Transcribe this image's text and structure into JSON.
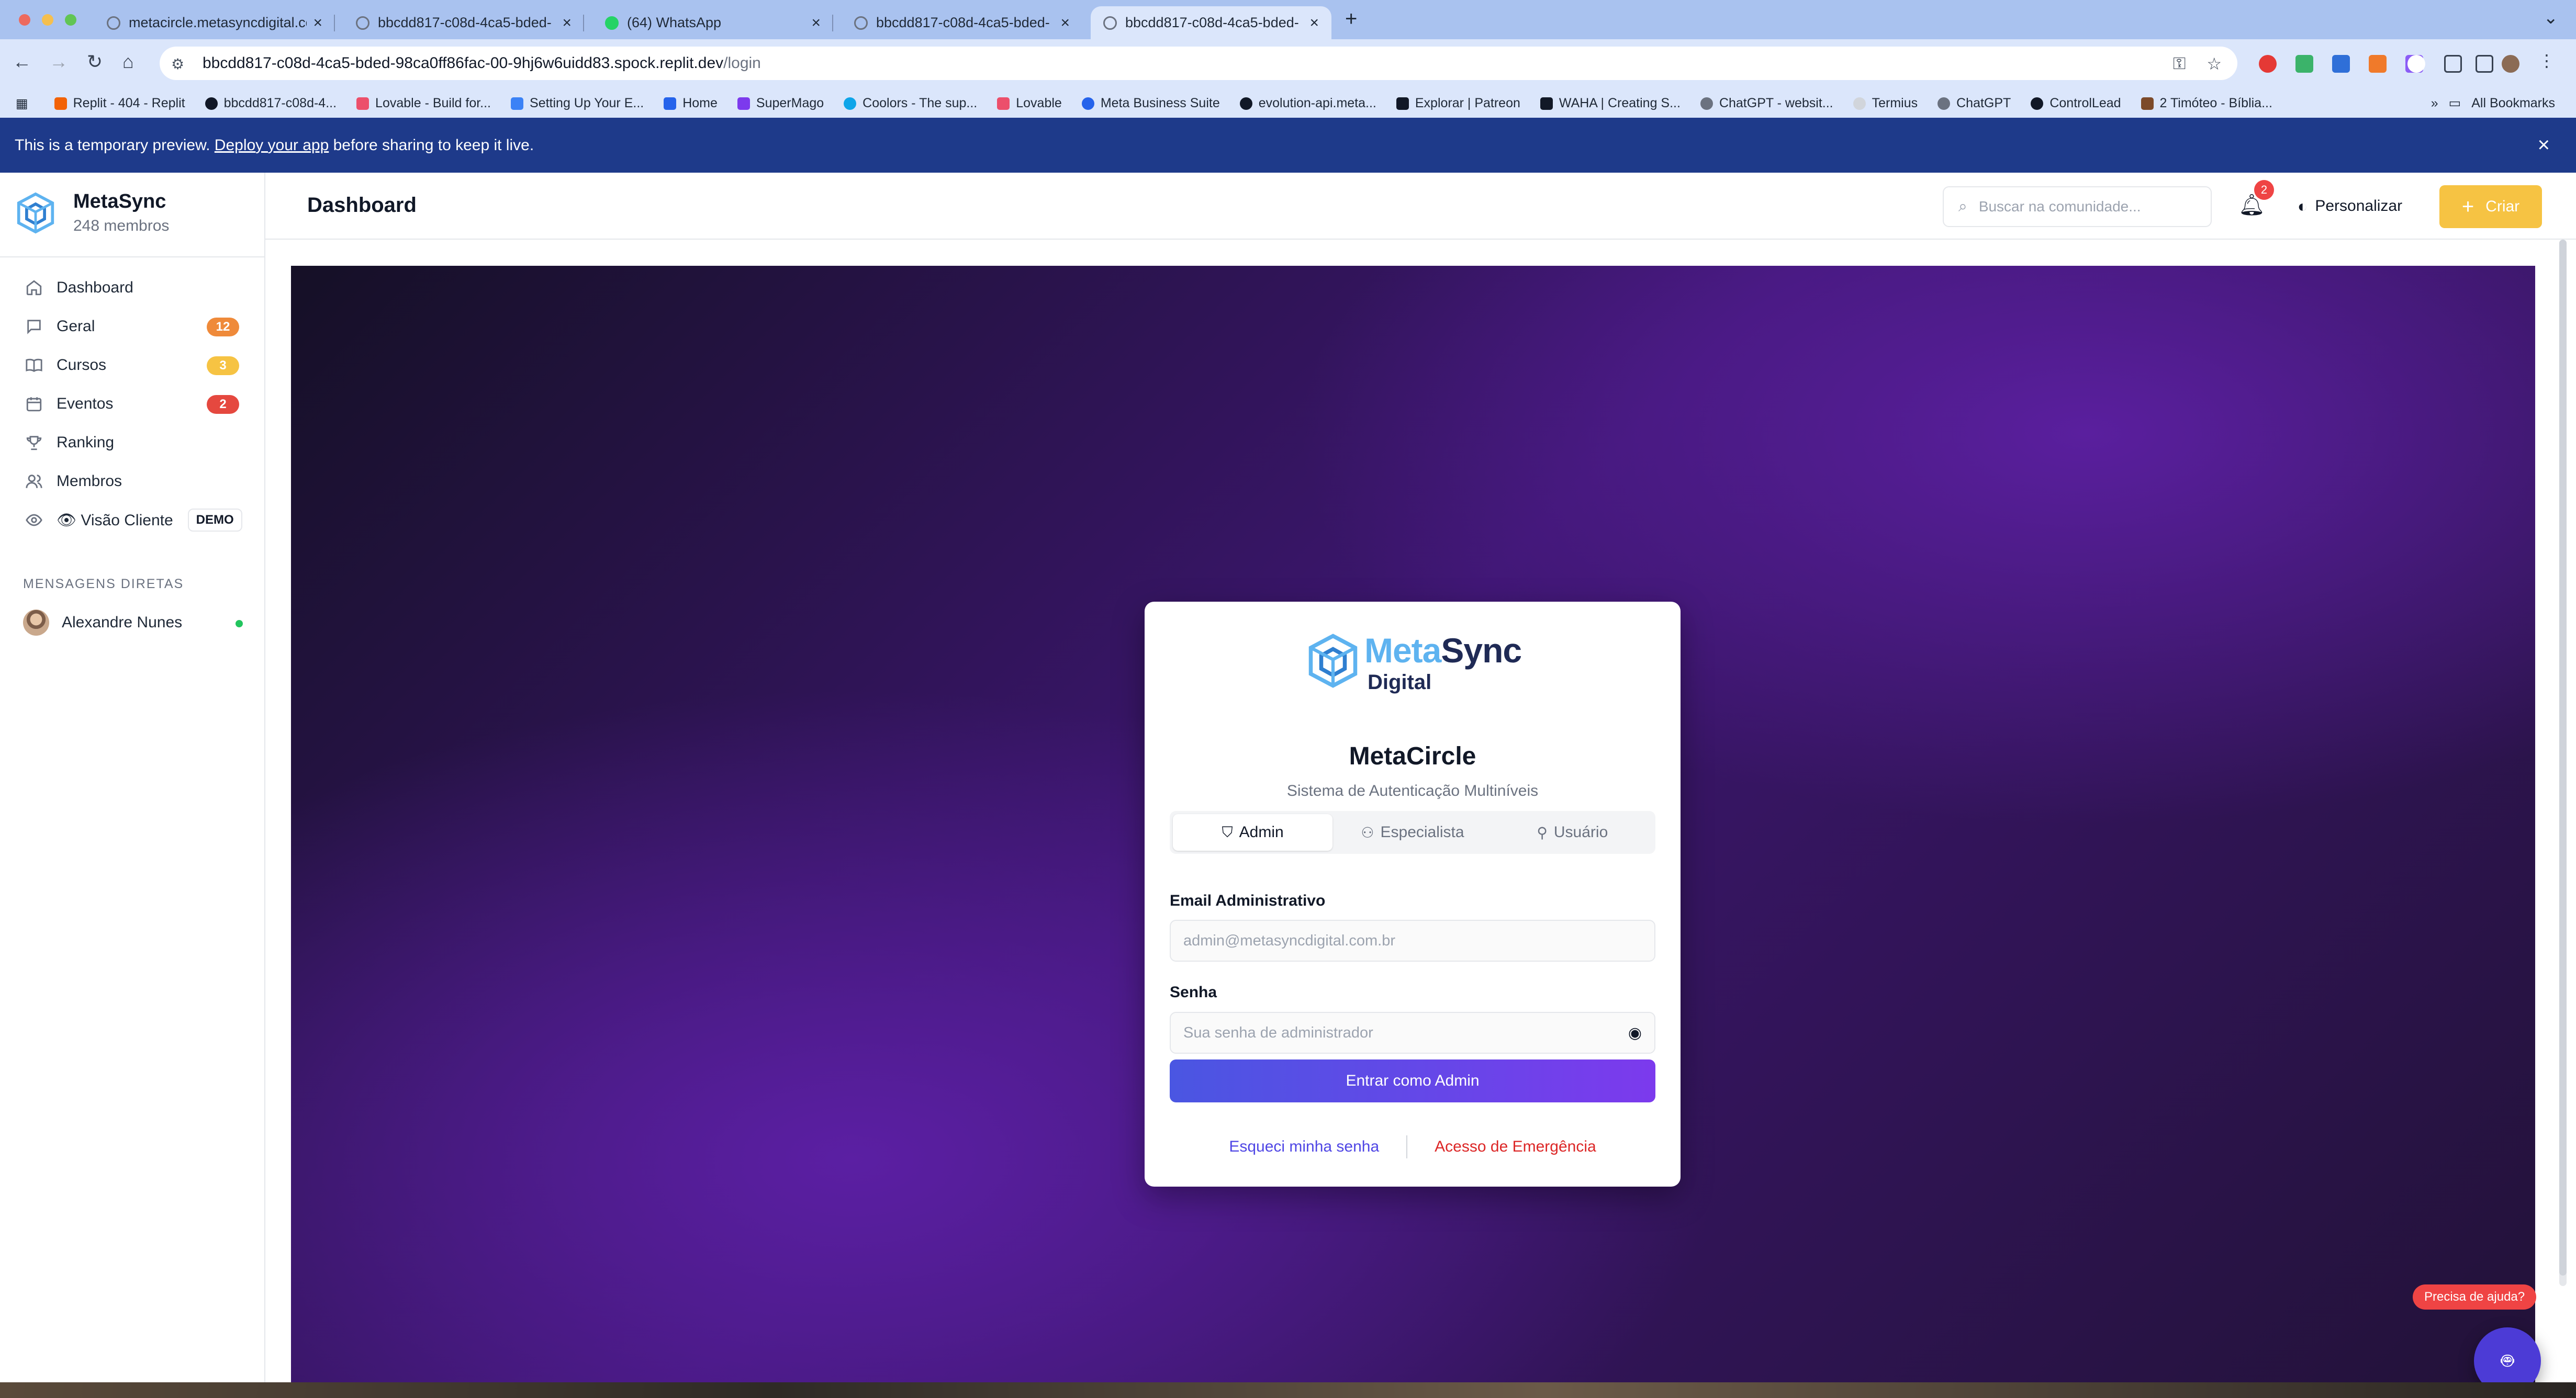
{
  "browser": {
    "tabs": [
      {
        "title": "metacircle.metasyncdigital.co",
        "active": false
      },
      {
        "title": "bbcdd817-c08d-4ca5-bded-",
        "active": false
      },
      {
        "title": "(64) WhatsApp",
        "active": false
      },
      {
        "title": "bbcdd817-c08d-4ca5-bded-",
        "active": false
      },
      {
        "title": "bbcdd817-c08d-4ca5-bded-",
        "active": true
      }
    ],
    "url_host": "bbcdd817-c08d-4ca5-bded-98ca0ff86fac-00-9hj6w6uidd83.spock.replit.dev",
    "url_path": "/login",
    "bookmarks": [
      "Replit - 404 - Replit",
      "bbcdd817-c08d-4...",
      "Lovable - Build for...",
      "Setting Up Your E...",
      "Home",
      "SuperMago",
      "Coolors - The sup...",
      "Lovable",
      "Meta Business Suite",
      "evolution-api.meta...",
      "Explorar | Patreon",
      "WAHA | Creating S...",
      "ChatGPT - websit...",
      "Termius",
      "ChatGPT",
      "ControlLead",
      "2 Timóteo - Bíblia..."
    ],
    "bookmarks_more": "»",
    "all_bookmarks": "All Bookmarks"
  },
  "banner": {
    "prefix": "This is a temporary preview. ",
    "link": "Deploy your app",
    "suffix": " before sharing to keep it live."
  },
  "sidebar": {
    "brand_name": "MetaSync",
    "brand_sub": "248 membros",
    "items": [
      {
        "label": "Dashboard",
        "icon": "home-icon",
        "badge": ""
      },
      {
        "label": "Geral",
        "icon": "chat-icon",
        "badge": "12",
        "badge_color": "#ef8a3a"
      },
      {
        "label": "Cursos",
        "icon": "book-icon",
        "badge": "3",
        "badge_color": "#f6c343"
      },
      {
        "label": "Eventos",
        "icon": "calendar-icon",
        "badge": "2",
        "badge_color": "#e5483f"
      },
      {
        "label": "Ranking",
        "icon": "trophy-icon",
        "badge": ""
      },
      {
        "label": "Membros",
        "icon": "users-icon",
        "badge": ""
      },
      {
        "label": "👁 Visão Cliente",
        "icon": "eye-icon",
        "badge": "",
        "tag": "DEMO"
      }
    ],
    "dm_title": "MENSAGENS DIRETAS",
    "dm_user": "Alexandre Nunes"
  },
  "topbar": {
    "title": "Dashboard",
    "search_placeholder": "Buscar na comunidade...",
    "notif_count": "2",
    "customize_label": "Personalizar",
    "create_label": "Criar"
  },
  "login": {
    "logo_meta": "Meta",
    "logo_sync": "Sync",
    "logo_digital": "Digital",
    "title": "MetaCircle",
    "subtitle": "Sistema de Autenticação Multiníveis",
    "tabs": [
      "Admin",
      "Especialista",
      "Usuário"
    ],
    "active_tab": "Admin",
    "email_label": "Email Administrativo",
    "email_placeholder": "admin@metasyncdigital.com.br",
    "password_label": "Senha",
    "password_placeholder": "Sua senha de administrador",
    "submit_label": "Entrar como Admin",
    "forgot_label": "Esqueci minha senha",
    "emergency_label": "Acesso de Emergência"
  },
  "help": {
    "pill_label": "Precisa de ajuda?"
  },
  "colors": {
    "accent_yellow": "#f6c343",
    "primary_gradient_start": "#4a56e2",
    "primary_gradient_end": "#7c3aed",
    "banner_blue": "#1e3a8a",
    "danger": "#dc2626"
  }
}
